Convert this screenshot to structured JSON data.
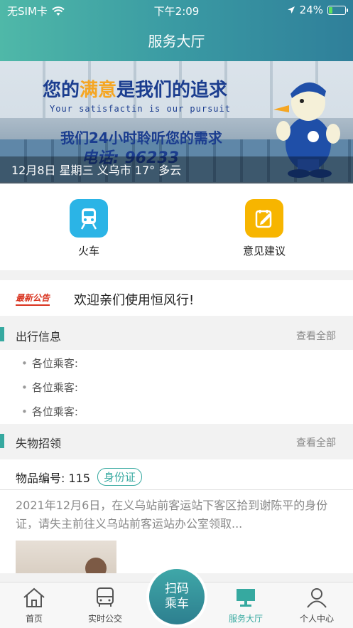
{
  "status_bar": {
    "carrier": "无SIM卡",
    "time": "下午2:09",
    "battery_percent": "24%",
    "battery_level": 0.24
  },
  "header": {
    "title": "服务大厅"
  },
  "banner": {
    "slogan_main_prefix": "您的",
    "slogan_main_highlight": "满意",
    "slogan_main_suffix": "是我们的追求",
    "slogan_english": "Your satisfactin is our pursuit",
    "slogan_secondary": "我们24小时聆听您的需求",
    "phone": "电话: 96233",
    "weather": "12月8日 星期三 义乌市 17° 多云"
  },
  "quick_actions": [
    {
      "label": "火车",
      "icon": "train-icon",
      "color": "#2bb4e6"
    },
    {
      "label": "意见建议",
      "icon": "feedback-icon",
      "color": "#f7b500"
    }
  ],
  "notice": {
    "badge": "最新公告",
    "text": "欢迎亲们使用恒风行!"
  },
  "trip_info": {
    "title": "出行信息",
    "more": "查看全部",
    "items": [
      "各位乘客:",
      "各位乘客:",
      "各位乘客:"
    ]
  },
  "lost_found": {
    "title": "失物招领",
    "more": "查看全部",
    "item_number_label": "物品编号:",
    "item_number": "115",
    "tag": "身份证",
    "description": "2021年12月6日，在义乌站前客运站下客区拾到谢陈平的身份证，请失主前往义乌站前客运站办公室领取..."
  },
  "tabbar": {
    "tabs": [
      {
        "label": "首页",
        "icon": "home-icon"
      },
      {
        "label": "实时公交",
        "icon": "bus-icon"
      },
      {
        "label": "服务大厅",
        "icon": "monitor-icon",
        "active": true
      },
      {
        "label": "个人中心",
        "icon": "user-icon"
      }
    ],
    "scan_line1": "扫码",
    "scan_line2": "乘车"
  },
  "colors": {
    "accent": "#36a9a0",
    "header_start": "#4fb8a8",
    "header_end": "#2f7f9a"
  }
}
